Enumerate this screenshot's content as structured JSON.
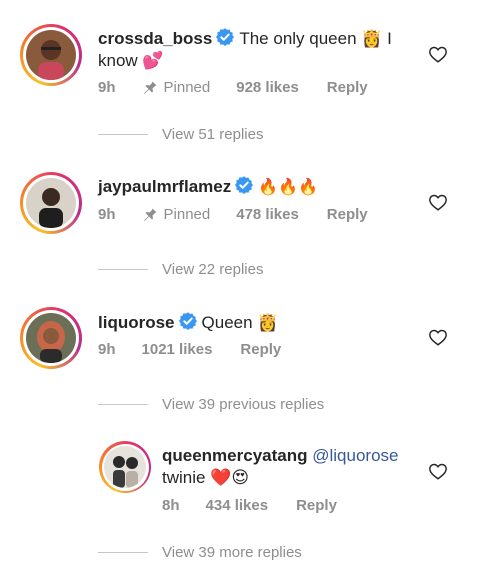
{
  "comments": [
    {
      "username": "crossda_boss",
      "verified": true,
      "text_line1": "The only queen 👸 I",
      "text_line2": "know 💕",
      "time": "9h",
      "pinned_label": "Pinned",
      "likes": "928 likes",
      "reply_label": "Reply",
      "view_replies": "View 51 replies"
    },
    {
      "username": "jaypaulmrflamez",
      "verified": true,
      "text": "🔥🔥🔥",
      "time": "9h",
      "pinned_label": "Pinned",
      "likes": "478 likes",
      "reply_label": "Reply",
      "view_replies": "View 22 replies"
    },
    {
      "username": "liquorose",
      "verified": true,
      "text": "Queen 👸",
      "time": "9h",
      "likes": "1021 likes",
      "reply_label": "Reply",
      "view_replies": "View 39 previous replies"
    }
  ],
  "reply": {
    "username": "queenmercyatang",
    "mention": "@liquorose",
    "text": "twinie ❤️😍",
    "time": "8h",
    "likes": "434 likes",
    "reply_label": "Reply"
  },
  "view_more_replies": "View 39 more replies",
  "colors": {
    "verified_blue": "#3897f0",
    "meta_gray": "#8e8e8e",
    "mention_blue": "#385898"
  },
  "icons": [
    "verified-badge-icon",
    "pin-icon",
    "heart-outline-icon"
  ]
}
